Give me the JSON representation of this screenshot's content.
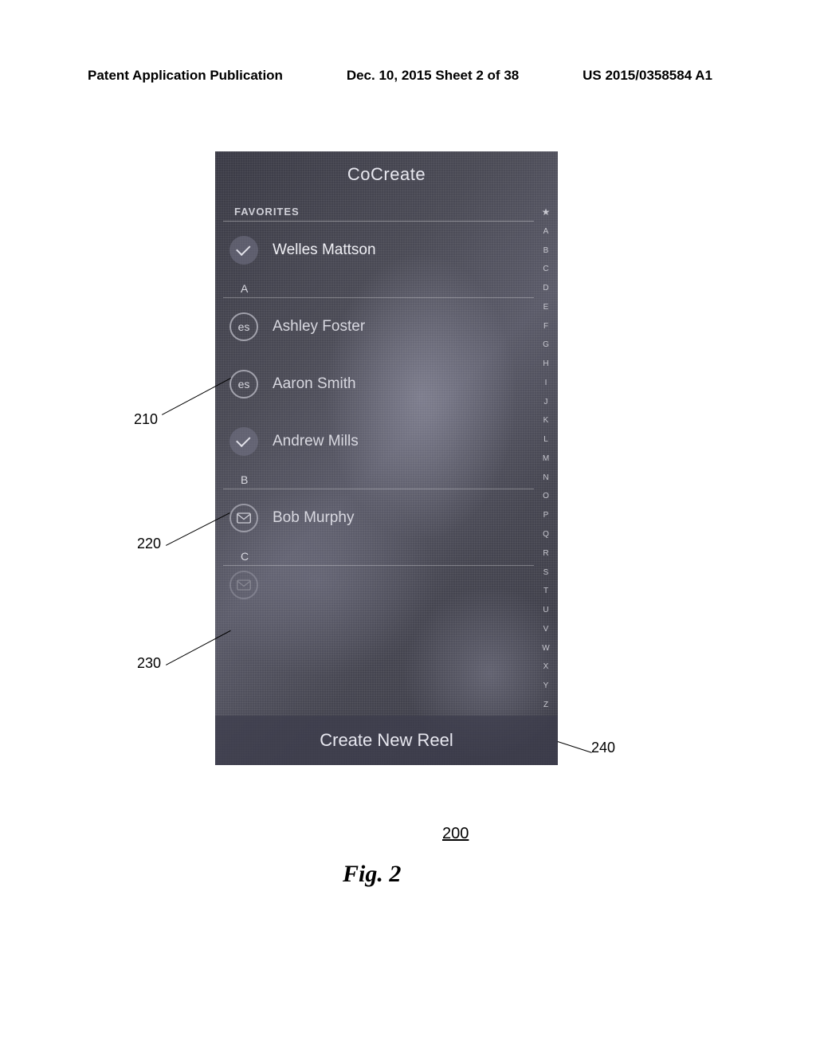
{
  "header": {
    "left": "Patent Application Publication",
    "center": "Dec. 10, 2015  Sheet 2 of 38",
    "right": "US 2015/0358584 A1"
  },
  "app": {
    "title": "CoCreate",
    "favorites_label": "FAVORITES",
    "bottom_button": "Create New Reel"
  },
  "contacts": {
    "favorites": [
      {
        "name": "Welles Mattson",
        "icon": "check"
      }
    ],
    "sections": [
      {
        "letter": "A",
        "items": [
          {
            "name": "Ashley Foster",
            "icon": "es"
          },
          {
            "name": "Aaron Smith",
            "icon": "es"
          },
          {
            "name": "Andrew Mills",
            "icon": "check"
          }
        ]
      },
      {
        "letter": "B",
        "items": [
          {
            "name": "Bob Murphy",
            "icon": "mail"
          }
        ]
      },
      {
        "letter": "C",
        "items": []
      }
    ]
  },
  "index_letters": [
    "★",
    "A",
    "B",
    "C",
    "D",
    "E",
    "F",
    "G",
    "H",
    "I",
    "J",
    "K",
    "L",
    "M",
    "N",
    "O",
    "P",
    "Q",
    "R",
    "S",
    "T",
    "U",
    "V",
    "W",
    "X",
    "Y",
    "Z"
  ],
  "callouts": {
    "c210": "210",
    "c220": "220",
    "c230": "230",
    "c240": "240",
    "fig_num": "200",
    "fig_label": "Fig. 2"
  }
}
